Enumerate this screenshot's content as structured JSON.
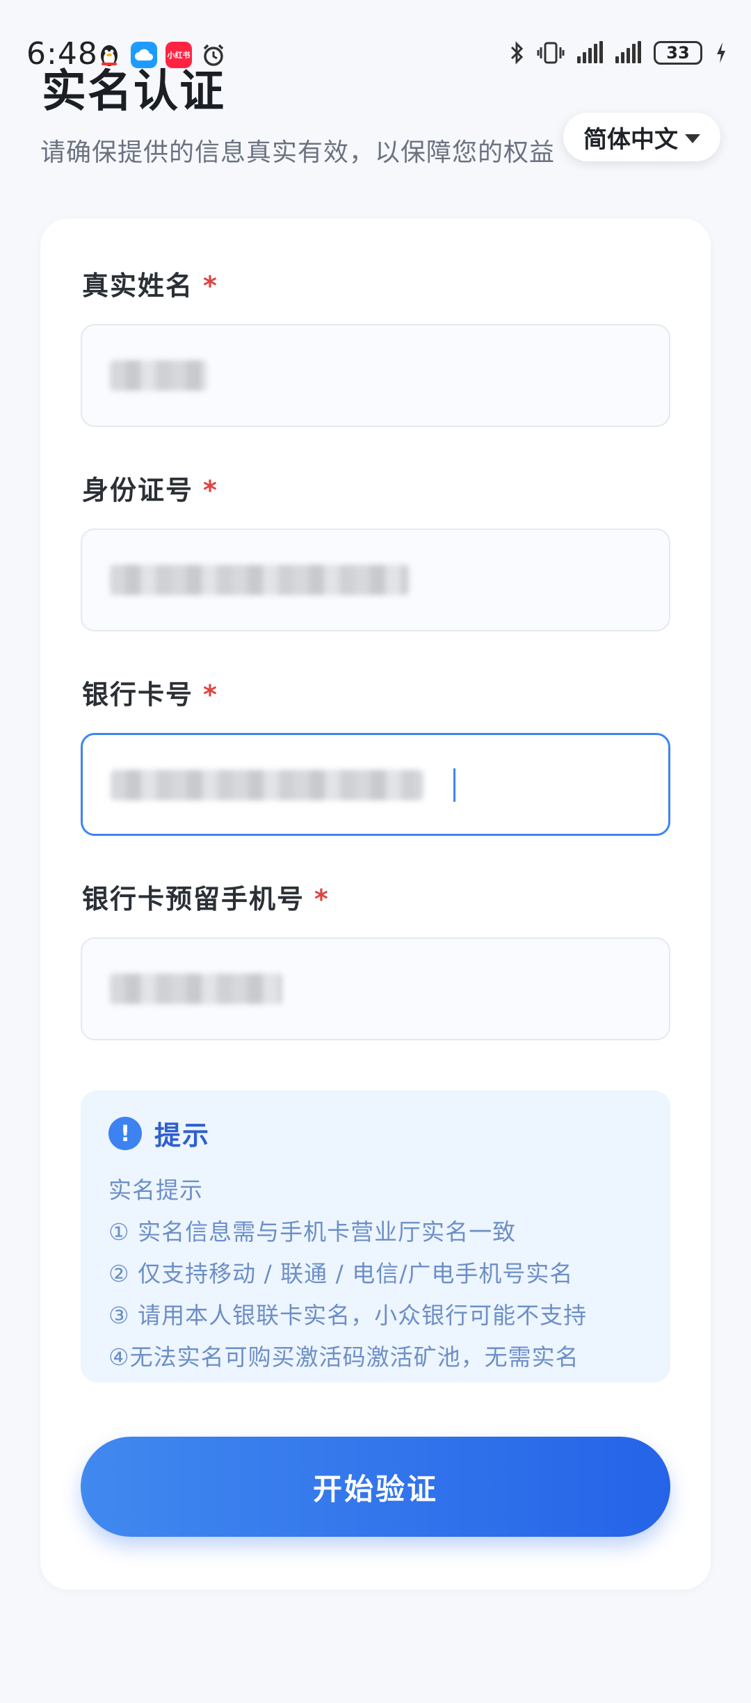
{
  "status_bar": {
    "time": "6:48",
    "battery": "33",
    "app_badge_text": "小红书"
  },
  "header": {
    "title": "实名认证",
    "subtitle": "请确保提供的信息真实有效，以保障您的权益",
    "language_select": "简体中文"
  },
  "form": {
    "fields": [
      {
        "label": "真实姓名",
        "required_mark": "*",
        "value": ""
      },
      {
        "label": "身份证号",
        "required_mark": "*",
        "value": ""
      },
      {
        "label": "银行卡号",
        "required_mark": "*",
        "value": ""
      },
      {
        "label": "银行卡预留手机号",
        "required_mark": "*",
        "value": ""
      }
    ]
  },
  "tips": {
    "icon": "!",
    "title": "提示",
    "lines": [
      "实名提示",
      "① 实名信息需与手机卡营业厅实名一致",
      "② 仅支持移动 / 联通 / 电信/广电手机号实名",
      "③ 请用本人银联卡实名，小众银行可能不支持",
      "④无法实名可购买激活码激活矿池，无需实名"
    ]
  },
  "submit_button": "开始验证",
  "colors": {
    "accent": "#2563e8",
    "required": "#e0423f",
    "tips_bg": "#edf5fe",
    "tips_title": "#2f5fcf"
  }
}
